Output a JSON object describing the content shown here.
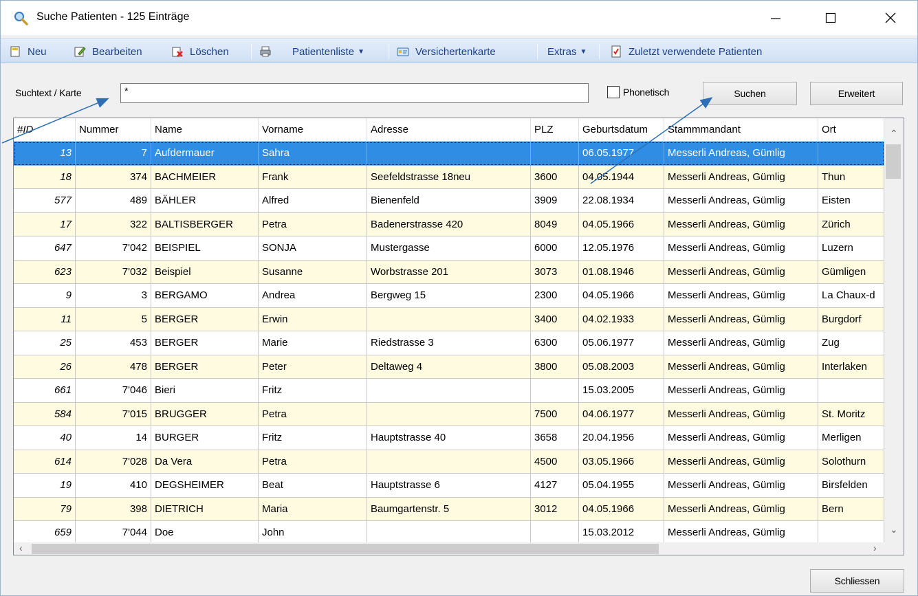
{
  "window": {
    "title": "Suche Patienten - 125 Einträge",
    "title_icon": "magnifier-icon",
    "controls": {
      "minimize": "—",
      "maximize": "☐",
      "close": "✕"
    }
  },
  "toolbar": {
    "items": [
      {
        "label": "Neu",
        "icon": "new-document-icon"
      },
      {
        "label": "Bearbeiten",
        "icon": "edit-icon"
      },
      {
        "label": "Löschen",
        "icon": "delete-icon"
      },
      {
        "label": "",
        "icon": "printer-icon"
      },
      {
        "label": "Patientenliste",
        "icon": "",
        "dropdown": true
      },
      {
        "label": "Versichertenkarte",
        "icon": "insurance-card-icon"
      },
      {
        "label": "Extras",
        "icon": "",
        "dropdown": true
      },
      {
        "label": "Zuletzt verwendete Patienten",
        "icon": "checklist-icon"
      }
    ]
  },
  "search": {
    "label": "Suchtext / Karte",
    "value": "*",
    "phonetic_label": "Phonetisch",
    "phonetic_checked": false,
    "search_button": "Suchen",
    "advanced_button": "Erweitert"
  },
  "grid": {
    "columns": [
      "#ID",
      "Nummer",
      "Name",
      "Vorname",
      "Adresse",
      "PLZ",
      "Geburtsdatum",
      "Stammmandant",
      "Ort"
    ],
    "selected_row": 0,
    "rows": [
      [
        "13",
        "7",
        "Aufdermauer",
        "Sahra",
        "",
        "",
        "06.05.1977",
        "Messerli Andreas, Gümlig",
        ""
      ],
      [
        "18",
        "374",
        "BACHMEIER",
        "Frank",
        "Seefeldstrasse 18neu",
        "3600",
        "04.05.1944",
        "Messerli Andreas, Gümlig",
        "Thun"
      ],
      [
        "577",
        "489",
        "BÄHLER",
        "Alfred",
        "Bienenfeld",
        "3909",
        "22.08.1934",
        "Messerli Andreas, Gümlig",
        "Eisten"
      ],
      [
        "17",
        "322",
        "BALTISBERGER",
        "Petra",
        "Badenerstrasse 420",
        "8049",
        "04.05.1966",
        "Messerli Andreas, Gümlig",
        "Zürich"
      ],
      [
        "647",
        "7'042",
        "BEISPIEL",
        "SONJA",
        "Mustergasse",
        "6000",
        "12.05.1976",
        "Messerli Andreas, Gümlig",
        "Luzern"
      ],
      [
        "623",
        "7'032",
        "Beispiel",
        "Susanne",
        "Worbstrasse 201",
        "3073",
        "01.08.1946",
        "Messerli Andreas, Gümlig",
        "Gümligen"
      ],
      [
        "9",
        "3",
        "BERGAMO",
        "Andrea",
        "Bergweg 15",
        "2300",
        "04.05.1966",
        "Messerli Andreas, Gümlig",
        "La Chaux-d"
      ],
      [
        "11",
        "5",
        "BERGER",
        "Erwin",
        "",
        "3400",
        "04.02.1933",
        "Messerli Andreas, Gümlig",
        "Burgdorf"
      ],
      [
        "25",
        "453",
        "BERGER",
        "Marie",
        "Riedstrasse 3",
        "6300",
        "05.06.1977",
        "Messerli Andreas, Gümlig",
        "Zug"
      ],
      [
        "26",
        "478",
        "BERGER",
        "Peter",
        "Deltaweg 4",
        "3800",
        "05.08.2003",
        "Messerli Andreas, Gümlig",
        "Interlaken"
      ],
      [
        "661",
        "7'046",
        "Bieri",
        "Fritz",
        "",
        "",
        "15.03.2005",
        "Messerli Andreas, Gümlig",
        ""
      ],
      [
        "584",
        "7'015",
        "BRUGGER",
        "Petra",
        "",
        "7500",
        "04.06.1977",
        "Messerli Andreas, Gümlig",
        "St. Moritz"
      ],
      [
        "40",
        "14",
        "BURGER",
        "Fritz",
        "Hauptstrasse 40",
        "3658",
        "20.04.1956",
        "Messerli Andreas, Gümlig",
        "Merligen"
      ],
      [
        "614",
        "7'028",
        "Da Vera",
        "Petra",
        "",
        "4500",
        "03.05.1966",
        "Messerli Andreas, Gümlig",
        "Solothurn"
      ],
      [
        "19",
        "410",
        "DEGSHEIMER",
        "Beat",
        "Hauptstrasse 6",
        "4127",
        "05.04.1955",
        "Messerli Andreas, Gümlig",
        "Birsfelden"
      ],
      [
        "79",
        "398",
        "DIETRICH",
        "Maria",
        "Baumgartenstr. 5",
        "3012",
        "04.05.1966",
        "Messerli Andreas, Gümlig",
        "Bern"
      ],
      [
        "659",
        "7'044",
        "Doe",
        "John",
        "",
        "",
        "15.03.2012",
        "Messerli Andreas, Gümlig",
        ""
      ]
    ]
  },
  "footer": {
    "close_button": "Schliessen"
  },
  "colors": {
    "selection": "#2f8ee3",
    "row_alt": "#fffbe0",
    "toolbar_text": "#1c3f86",
    "annotation_arrow": "#2e6fb5"
  }
}
